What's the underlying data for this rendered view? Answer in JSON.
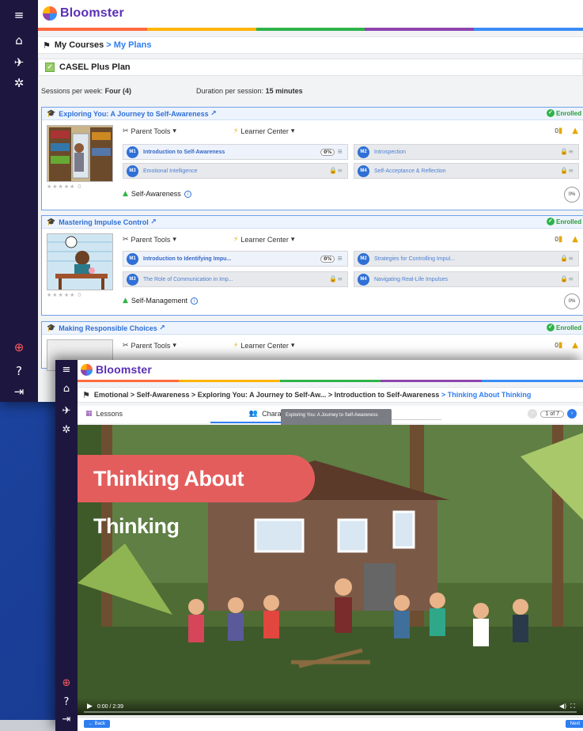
{
  "app": {
    "name": "Bloomster"
  },
  "back_window": {
    "breadcrumb": {
      "root": "My Courses",
      "sep": ">",
      "current": "My Plans"
    },
    "plan_title": "CASEL Plus Plan",
    "sessions_label": "Sessions per week:",
    "sessions_value": "Four (4)",
    "duration_label": "Duration per session:",
    "duration_value": "15 minutes",
    "parent_tools": "Parent Tools",
    "learner_center": "Learner Center",
    "enrolled": "Enrolled",
    "rating_count": "0",
    "courses": [
      {
        "title": "Exploring You: A Journey to Self-Awareness",
        "skill": "Self-Awareness",
        "progress": "0%",
        "modules": [
          {
            "num": "M1",
            "title": "Introduction to Self-Awareness",
            "status": "0%"
          },
          {
            "num": "M2",
            "title": "Introspection",
            "status": "locked"
          },
          {
            "num": "M3",
            "title": "Emotional Intelligence",
            "status": "locked"
          },
          {
            "num": "M4",
            "title": "Self-Acceptance & Reflection",
            "status": "locked"
          }
        ]
      },
      {
        "title": "Mastering Impulse Control",
        "skill": "Self-Management",
        "progress": "0%",
        "modules": [
          {
            "num": "M1",
            "title": "Introduction to Identifying Impu...",
            "status": "0%"
          },
          {
            "num": "M2",
            "title": "Strategies for Controlling Impul...",
            "status": "locked"
          },
          {
            "num": "M3",
            "title": "The Role of Communication in Imp...",
            "status": "locked"
          },
          {
            "num": "M4",
            "title": "Navigating Real-Life Impulses",
            "status": "locked"
          }
        ]
      },
      {
        "title": "Making Responsible Choices"
      }
    ]
  },
  "front_window": {
    "breadcrumb": {
      "items": [
        "Emotional",
        "Self-Awareness",
        "Exploring You: A Journey to Self-Aw...",
        "Introduction to Self-Awareness"
      ],
      "current": "Thinking About Thinking"
    },
    "tabs": {
      "lessons": "Lessons",
      "characters": "Characters"
    },
    "tooltip": "Exploring You: A Journey to Self-Awareness",
    "pager": "1 of 7",
    "video": {
      "title": "Thinking About Thinking",
      "time": "0:00 / 2:39"
    },
    "back_label": "← Back",
    "next_label": "Next"
  },
  "colors": {
    "brand": "#5a2fb5",
    "accent": "#2f7ef0",
    "sidebar": "#1d1740",
    "title_banner": "#e45d5d"
  }
}
